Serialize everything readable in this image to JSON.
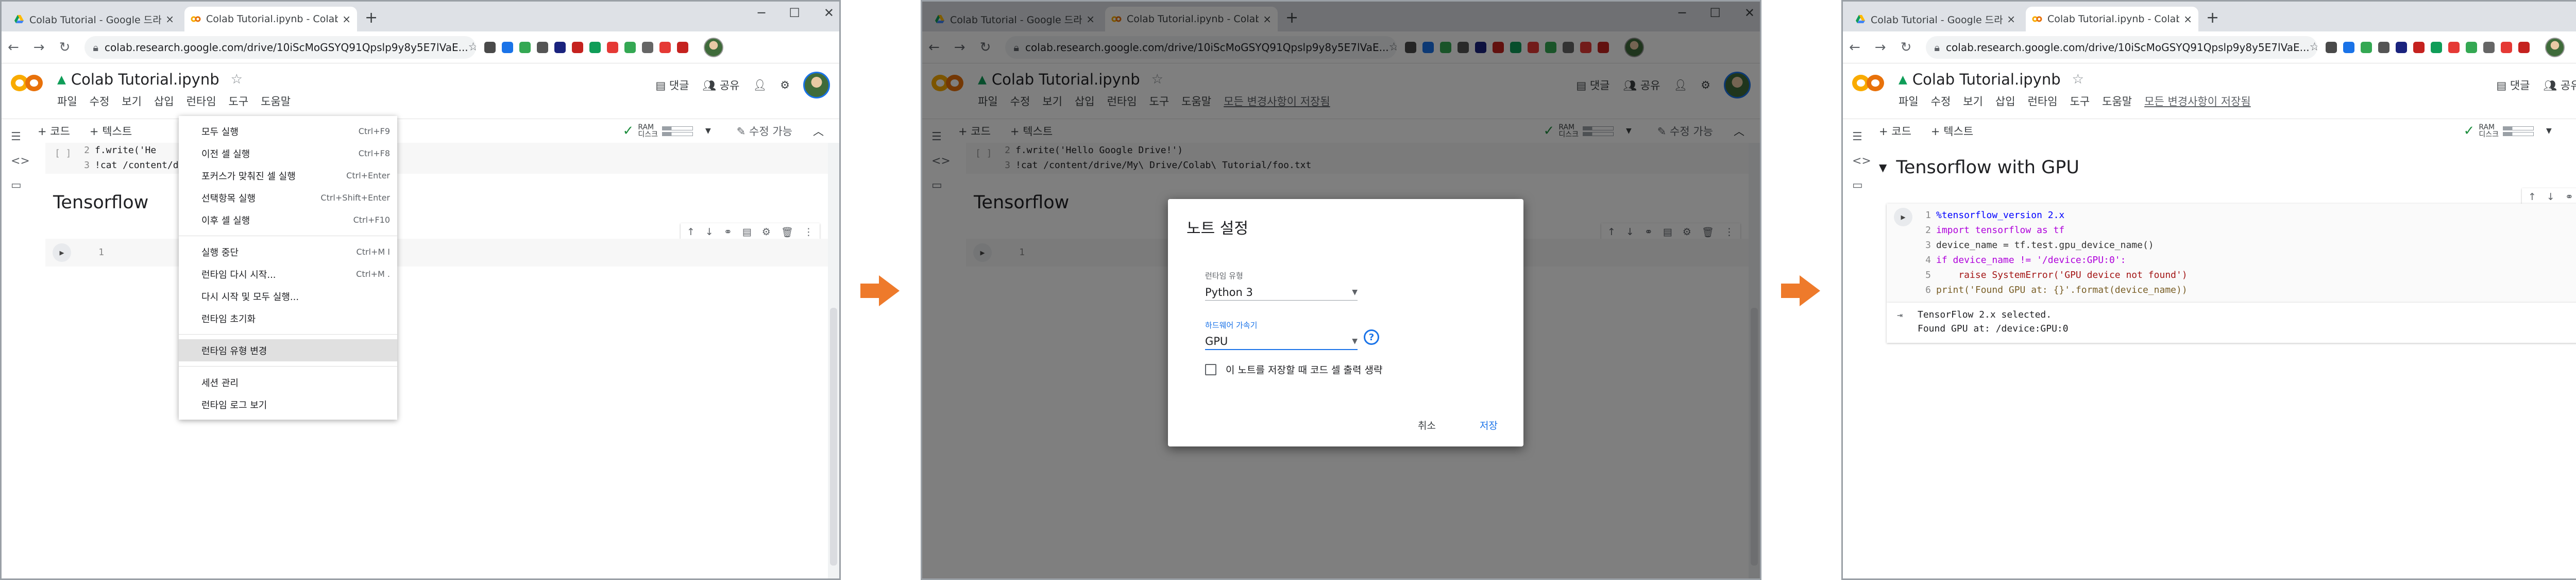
{
  "browser": {
    "tabs": [
      "Colab Tutorial - Google 드라이브",
      "Colab Tutorial.ipynb - Colabora"
    ],
    "url": "colab.research.google.com/drive/10iScMoGSYQ91Qpslp9y8y5E7lVaE...",
    "new_tab": "+",
    "window_controls": [
      "─",
      "☐",
      "✕"
    ]
  },
  "colab": {
    "title": "Colab Tutorial.ipynb",
    "menus": [
      "파일",
      "수정",
      "보기",
      "삽입",
      "런타임",
      "도구",
      "도움말"
    ],
    "unsaved": "모든 변경사항이 저장됨",
    "comment": "댓글",
    "share": "공유",
    "add_code": "+ 코드",
    "add_text": "+ 텍스트",
    "ram": "RAM",
    "disk": "디스크",
    "edit_mode": "수정 가능"
  },
  "panel1": {
    "code_lines": [
      {
        "n": "2",
        "t": "f.write('He"
      },
      {
        "n": "3",
        "t": "!cat /content/d"
      }
    ],
    "heading": "Tensorflow",
    "empty_cell_ln": "1",
    "runtime_menu": [
      {
        "label": "모두 실행",
        "shortcut": "Ctrl+F9"
      },
      {
        "label": "이전 셀 실행",
        "shortcut": "Ctrl+F8"
      },
      {
        "label": "포커스가 맞춰진 셀 실행",
        "shortcut": "Ctrl+Enter"
      },
      {
        "label": "선택항목 실행",
        "shortcut": "Ctrl+Shift+Enter"
      },
      {
        "label": "이후 셀 실행",
        "shortcut": "Ctrl+F10"
      },
      {
        "label": "실행 중단",
        "shortcut": "Ctrl+M I"
      },
      {
        "label": "런타임 다시 시작...",
        "shortcut": "Ctrl+M ."
      },
      {
        "label": "다시 시작 및 모두 실행...",
        "shortcut": ""
      },
      {
        "label": "런타임 초기화",
        "shortcut": ""
      },
      {
        "label": "런타임 유형 변경",
        "shortcut": ""
      },
      {
        "label": "세션 관리",
        "shortcut": ""
      },
      {
        "label": "런타임 로그 보기",
        "shortcut": ""
      }
    ]
  },
  "panel2": {
    "code_lines": [
      {
        "n": "2",
        "t": "f.write('Hello Google Drive!')"
      },
      {
        "n": "3",
        "t": "!cat /content/drive/My\\ Drive/Colab\\ Tutorial/foo.txt"
      }
    ],
    "heading": "Tensorflow",
    "empty_cell_ln": "1",
    "dialog": {
      "title": "노트 설정",
      "runtime_type_label": "런타임 유형",
      "runtime_type": "Python 3",
      "accelerator_label": "하드웨어 가속기",
      "accelerator": "GPU",
      "omit_output": "이 노트를 저장할 때 코드 셀 출력 생략",
      "cancel": "취소",
      "save": "저장"
    }
  },
  "panel3": {
    "heading": "Tensorflow with GPU",
    "code": [
      {
        "n": "1",
        "t": "%tensorflow_version 2.x"
      },
      {
        "n": "2",
        "t": "import tensorflow as tf"
      },
      {
        "n": "3",
        "t": "device_name = tf.test.gpu_device_name()"
      },
      {
        "n": "4",
        "t": "if device_name != '/device:GPU:0':"
      },
      {
        "n": "5",
        "t": "    raise SystemError('GPU device not found')"
      },
      {
        "n": "6",
        "t": "print('Found GPU at: {}'.format(device_name))"
      }
    ],
    "output": [
      "TensorFlow 2.x selected.",
      "Found GPU at: /device:GPU:0"
    ]
  },
  "icons": {
    "arrow": "right-arrow-icon"
  }
}
